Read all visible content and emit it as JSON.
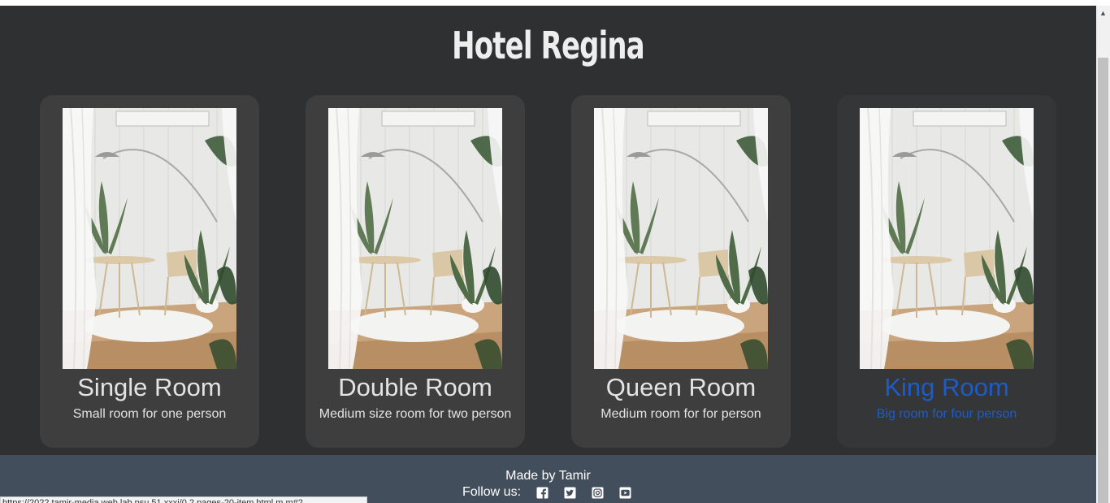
{
  "page": {
    "title": "Hotel Regina"
  },
  "rooms": [
    {
      "name": "Single Room",
      "description": "Small room for one person",
      "image_icon": "room-photo"
    },
    {
      "name": "Double Room",
      "description": "Medium size room for two person",
      "image_icon": "room-photo"
    },
    {
      "name": "Queen Room",
      "description": "Medium room for for person",
      "image_icon": "room-photo"
    },
    {
      "name": "King Room",
      "description": "Big room for four person",
      "image_icon": "room-photo",
      "state": "hovered"
    }
  ],
  "footer": {
    "made_by": "Made by Tamir",
    "follow_label": "Follow us:",
    "social": [
      "facebook-icon",
      "twitter-icon",
      "instagram-icon",
      "youtube-icon"
    ]
  },
  "status_bar": {
    "url": "https://2022.tamir-media.web.lab.psu.51.xxxi/0.2.pages-20-item.html.m.m#2..."
  },
  "colors": {
    "background": "#2f3032",
    "card": "#3e3e3e",
    "card_hover": "#353637",
    "hover_text": "#1f5bc6",
    "footer": "#434e5d"
  }
}
